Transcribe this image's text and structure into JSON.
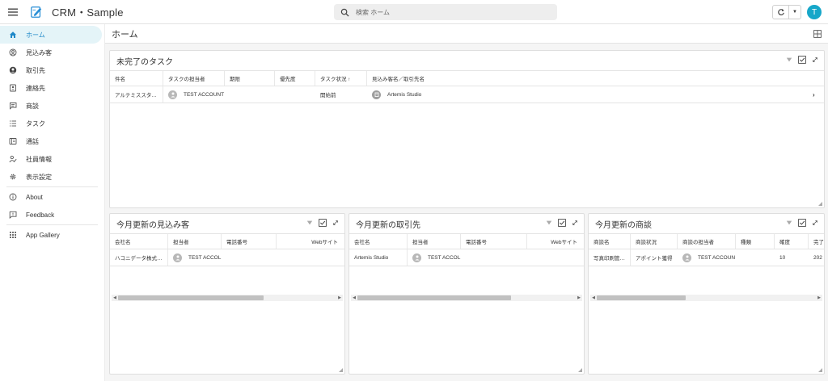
{
  "app": {
    "title": "CRM・Sample",
    "user_initial": "T"
  },
  "search": {
    "placeholder": "検索 ホーム"
  },
  "sidebar": {
    "items": [
      {
        "label": "ホーム",
        "icon": "home-icon",
        "active": true
      },
      {
        "label": "見込み客",
        "icon": "prospect-icon"
      },
      {
        "label": "取引先",
        "icon": "account-icon"
      },
      {
        "label": "連絡先",
        "icon": "contact-icon"
      },
      {
        "label": "商談",
        "icon": "deal-icon"
      },
      {
        "label": "タスク",
        "icon": "task-icon"
      },
      {
        "label": "通話",
        "icon": "call-icon"
      },
      {
        "label": "社員情報",
        "icon": "employee-icon"
      },
      {
        "label": "表示設定",
        "icon": "gear-icon"
      },
      {
        "label": "About",
        "icon": "info-icon"
      },
      {
        "label": "Feedback",
        "icon": "feedback-icon"
      },
      {
        "label": "App Gallery",
        "icon": "apps-grid-icon"
      }
    ]
  },
  "main": {
    "title": "ホーム"
  },
  "tasks_panel": {
    "title": "未完了のタスク",
    "columns": [
      "件名",
      "タスクの担当者",
      "期限",
      "優先度",
      "タスク状況 ↑",
      "見込み客名／取引先名"
    ],
    "rows": [
      {
        "subject": "アルテミススタ…",
        "owner": "TEST ACCOUNT",
        "due": "",
        "priority": "",
        "status": "開始前",
        "related": "Artemis Studio"
      }
    ]
  },
  "prospects_panel": {
    "title": "今月更新の見込み客",
    "columns": [
      "会社名",
      "担当者",
      "電話番号",
      "Webサイト"
    ],
    "rows": [
      {
        "company": "ハコニデータ株式…",
        "owner": "TEST ACCOL",
        "phone": "",
        "web": ""
      }
    ]
  },
  "accounts_panel": {
    "title": "今月更新の取引先",
    "columns": [
      "会社名",
      "担当者",
      "電話番号",
      "Webサイト"
    ],
    "rows": [
      {
        "company": "Artemis Studio",
        "owner": "TEST ACCOL",
        "phone": "",
        "web": ""
      }
    ]
  },
  "deals_panel": {
    "title": "今月更新の商談",
    "columns": [
      "商談名",
      "商談状況",
      "商談の担当者",
      "種類",
      "確度",
      "完了"
    ],
    "rows": [
      {
        "name": "写真印刷管…",
        "status": "アポイント獲得",
        "owner": "TEST ACCOUN",
        "kind": "",
        "probability": "10",
        "closed": "202"
      }
    ]
  },
  "colors": {
    "accent": "#1e88c8",
    "avatar": "#17a7c9",
    "active_bg": "#e4f4f8"
  }
}
